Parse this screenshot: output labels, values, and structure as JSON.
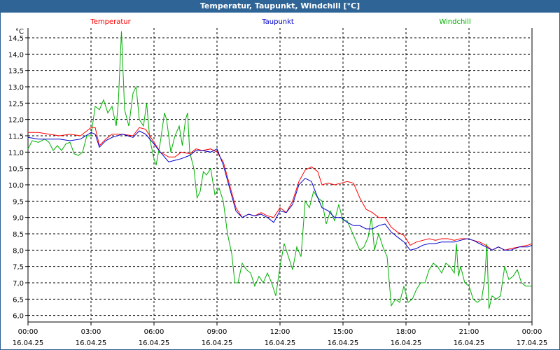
{
  "window": {
    "title": "Temperatur, Taupunkt, Windchill [°C]"
  },
  "colors": {
    "titlebar": "#2e6496",
    "temperatur": "#ff0000",
    "taupunkt": "#0000cc",
    "windchill": "#00b000",
    "grid": "#000000"
  },
  "chart_data": {
    "type": "line",
    "title": "Temperatur, Taupunkt, Windchill [°C]",
    "y_unit": "°C",
    "ylim": [
      5.8,
      14.8
    ],
    "y_ticks": [
      "6,0",
      "6,5",
      "7,0",
      "7,5",
      "8,0",
      "8,5",
      "9,0",
      "9,5",
      "10,0",
      "10,5",
      "11,0",
      "11,5",
      "12,0",
      "12,5",
      "13,0",
      "13,5",
      "14,0",
      "14,5"
    ],
    "xlim_hours": [
      0,
      24
    ],
    "x_ticks": [
      {
        "time": "00:00",
        "date": "16.04.25"
      },
      {
        "time": "03:00",
        "date": "16.04.25"
      },
      {
        "time": "06:00",
        "date": "16.04.25"
      },
      {
        "time": "09:00",
        "date": "16.04.25"
      },
      {
        "time": "12:00",
        "date": "16.04.25"
      },
      {
        "time": "15:00",
        "date": "16.04.25"
      },
      {
        "time": "18:00",
        "date": "16.04.25"
      },
      {
        "time": "21:00",
        "date": "16.04.25"
      },
      {
        "time": "00:00",
        "date": "17.04.25"
      }
    ],
    "grid": true,
    "legend_placement": "top",
    "series": [
      {
        "name": "Temperatur",
        "color": "#ff0000",
        "points": [
          [
            0,
            11.6
          ],
          [
            0.5,
            11.6
          ],
          [
            1.0,
            11.55
          ],
          [
            1.5,
            11.5
          ],
          [
            2.0,
            11.55
          ],
          [
            2.5,
            11.5
          ],
          [
            3.0,
            11.75
          ],
          [
            3.2,
            11.75
          ],
          [
            3.4,
            11.2
          ],
          [
            3.7,
            11.4
          ],
          [
            4.0,
            11.55
          ],
          [
            4.5,
            11.55
          ],
          [
            5.0,
            11.5
          ],
          [
            5.3,
            11.75
          ],
          [
            5.6,
            11.7
          ],
          [
            6.0,
            11.3
          ],
          [
            6.3,
            11.0
          ],
          [
            6.7,
            10.85
          ],
          [
            7.0,
            10.85
          ],
          [
            7.3,
            11.0
          ],
          [
            7.7,
            10.95
          ],
          [
            8.0,
            11.1
          ],
          [
            8.3,
            11.05
          ],
          [
            8.7,
            11.1
          ],
          [
            9.0,
            11.0
          ],
          [
            9.3,
            10.7
          ],
          [
            9.6,
            10.0
          ],
          [
            9.9,
            9.3
          ],
          [
            10.2,
            9.0
          ],
          [
            10.5,
            9.1
          ],
          [
            10.8,
            9.05
          ],
          [
            11.1,
            9.15
          ],
          [
            11.4,
            9.05
          ],
          [
            11.7,
            9.0
          ],
          [
            12.0,
            9.3
          ],
          [
            12.3,
            9.15
          ],
          [
            12.6,
            9.5
          ],
          [
            12.9,
            10.1
          ],
          [
            13.2,
            10.45
          ],
          [
            13.5,
            10.55
          ],
          [
            13.8,
            10.4
          ],
          [
            14.0,
            10.0
          ],
          [
            14.3,
            10.05
          ],
          [
            14.6,
            10.0
          ],
          [
            14.9,
            10.05
          ],
          [
            15.2,
            10.1
          ],
          [
            15.5,
            10.05
          ],
          [
            15.8,
            9.6
          ],
          [
            16.1,
            9.25
          ],
          [
            16.4,
            9.15
          ],
          [
            16.7,
            9.0
          ],
          [
            17.0,
            9.0
          ],
          [
            17.3,
            8.7
          ],
          [
            17.6,
            8.55
          ],
          [
            17.9,
            8.45
          ],
          [
            18.2,
            8.15
          ],
          [
            18.5,
            8.25
          ],
          [
            18.8,
            8.3
          ],
          [
            19.1,
            8.35
          ],
          [
            19.4,
            8.3
          ],
          [
            19.7,
            8.35
          ],
          [
            20.0,
            8.35
          ],
          [
            20.3,
            8.3
          ],
          [
            20.6,
            8.35
          ],
          [
            20.9,
            8.35
          ],
          [
            21.2,
            8.3
          ],
          [
            21.5,
            8.25
          ],
          [
            21.8,
            8.15
          ],
          [
            22.1,
            8.0
          ],
          [
            22.4,
            8.1
          ],
          [
            22.7,
            8.0
          ],
          [
            23.0,
            8.05
          ],
          [
            23.4,
            8.1
          ],
          [
            23.8,
            8.15
          ],
          [
            24.0,
            8.2
          ]
        ]
      },
      {
        "name": "Taupunkt",
        "color": "#0000cc",
        "points": [
          [
            0,
            11.45
          ],
          [
            0.5,
            11.4
          ],
          [
            1.0,
            11.4
          ],
          [
            1.5,
            11.4
          ],
          [
            2.0,
            11.35
          ],
          [
            2.5,
            11.4
          ],
          [
            3.0,
            11.6
          ],
          [
            3.2,
            11.55
          ],
          [
            3.4,
            11.15
          ],
          [
            3.7,
            11.35
          ],
          [
            4.0,
            11.45
          ],
          [
            4.5,
            11.55
          ],
          [
            5.0,
            11.45
          ],
          [
            5.3,
            11.65
          ],
          [
            5.6,
            11.55
          ],
          [
            6.0,
            11.25
          ],
          [
            6.3,
            11.0
          ],
          [
            6.7,
            10.7
          ],
          [
            7.0,
            10.75
          ],
          [
            7.3,
            10.8
          ],
          [
            7.7,
            10.9
          ],
          [
            8.0,
            11.05
          ],
          [
            8.3,
            11.05
          ],
          [
            8.7,
            11.0
          ],
          [
            9.0,
            11.1
          ],
          [
            9.3,
            10.6
          ],
          [
            9.6,
            9.9
          ],
          [
            9.9,
            9.2
          ],
          [
            10.2,
            9.0
          ],
          [
            10.5,
            9.1
          ],
          [
            10.8,
            9.05
          ],
          [
            11.1,
            9.1
          ],
          [
            11.4,
            9.0
          ],
          [
            11.7,
            8.85
          ],
          [
            12.0,
            9.2
          ],
          [
            12.3,
            9.15
          ],
          [
            12.6,
            9.4
          ],
          [
            12.9,
            10.0
          ],
          [
            13.2,
            10.2
          ],
          [
            13.5,
            10.1
          ],
          [
            13.8,
            9.6
          ],
          [
            14.0,
            9.3
          ],
          [
            14.3,
            9.2
          ],
          [
            14.6,
            9.0
          ],
          [
            14.9,
            9.0
          ],
          [
            15.2,
            8.85
          ],
          [
            15.5,
            8.75
          ],
          [
            15.8,
            8.75
          ],
          [
            16.1,
            8.65
          ],
          [
            16.4,
            8.65
          ],
          [
            16.7,
            8.75
          ],
          [
            17.0,
            8.8
          ],
          [
            17.3,
            8.55
          ],
          [
            17.6,
            8.4
          ],
          [
            17.9,
            8.25
          ],
          [
            18.2,
            8.0
          ],
          [
            18.5,
            8.05
          ],
          [
            18.8,
            8.15
          ],
          [
            19.1,
            8.2
          ],
          [
            19.4,
            8.2
          ],
          [
            19.7,
            8.25
          ],
          [
            20.0,
            8.25
          ],
          [
            20.3,
            8.25
          ],
          [
            20.6,
            8.3
          ],
          [
            20.9,
            8.35
          ],
          [
            21.2,
            8.3
          ],
          [
            21.5,
            8.2
          ],
          [
            21.8,
            8.1
          ],
          [
            22.1,
            8.0
          ],
          [
            22.4,
            8.1
          ],
          [
            22.7,
            8.0
          ],
          [
            23.0,
            8.0
          ],
          [
            23.4,
            8.1
          ],
          [
            23.8,
            8.1
          ],
          [
            24.0,
            8.15
          ]
        ]
      },
      {
        "name": "Windchill",
        "color": "#00b000",
        "points": [
          [
            0,
            11.1
          ],
          [
            0.2,
            11.35
          ],
          [
            0.5,
            11.3
          ],
          [
            0.8,
            11.4
          ],
          [
            1.0,
            11.3
          ],
          [
            1.2,
            11.05
          ],
          [
            1.4,
            11.2
          ],
          [
            1.6,
            11.05
          ],
          [
            1.8,
            11.25
          ],
          [
            2.0,
            11.3
          ],
          [
            2.2,
            10.95
          ],
          [
            2.4,
            10.9
          ],
          [
            2.6,
            11.0
          ],
          [
            2.8,
            11.5
          ],
          [
            3.0,
            11.5
          ],
          [
            3.2,
            12.4
          ],
          [
            3.4,
            12.3
          ],
          [
            3.6,
            12.6
          ],
          [
            3.8,
            12.2
          ],
          [
            4.0,
            12.4
          ],
          [
            4.2,
            11.8
          ],
          [
            4.3,
            12.5
          ],
          [
            4.45,
            14.7
          ],
          [
            4.6,
            12.3
          ],
          [
            4.8,
            11.8
          ],
          [
            5.0,
            12.8
          ],
          [
            5.15,
            13.0
          ],
          [
            5.3,
            12.0
          ],
          [
            5.5,
            11.8
          ],
          [
            5.65,
            12.5
          ],
          [
            5.8,
            11.4
          ],
          [
            6.0,
            10.8
          ],
          [
            6.1,
            10.6
          ],
          [
            6.3,
            11.3
          ],
          [
            6.5,
            12.2
          ],
          [
            6.6,
            12.0
          ],
          [
            6.8,
            11.0
          ],
          [
            7.0,
            11.5
          ],
          [
            7.2,
            11.8
          ],
          [
            7.35,
            11.2
          ],
          [
            7.5,
            12.0
          ],
          [
            7.6,
            12.2
          ],
          [
            7.7,
            11.0
          ],
          [
            7.9,
            10.5
          ],
          [
            8.05,
            9.6
          ],
          [
            8.2,
            9.8
          ],
          [
            8.35,
            10.4
          ],
          [
            8.5,
            10.3
          ],
          [
            8.7,
            10.5
          ],
          [
            8.9,
            9.7
          ],
          [
            9.1,
            9.9
          ],
          [
            9.3,
            9.5
          ],
          [
            9.5,
            8.5
          ],
          [
            9.7,
            7.9
          ],
          [
            9.85,
            7.0
          ],
          [
            10.0,
            7.0
          ],
          [
            10.2,
            7.6
          ],
          [
            10.4,
            7.4
          ],
          [
            10.6,
            7.3
          ],
          [
            10.8,
            6.9
          ],
          [
            11.0,
            7.2
          ],
          [
            11.2,
            7.0
          ],
          [
            11.4,
            7.3
          ],
          [
            11.6,
            7.0
          ],
          [
            11.8,
            6.6
          ],
          [
            12.0,
            7.5
          ],
          [
            12.2,
            8.2
          ],
          [
            12.4,
            7.8
          ],
          [
            12.6,
            7.4
          ],
          [
            12.8,
            8.1
          ],
          [
            13.0,
            7.8
          ],
          [
            13.2,
            9.5
          ],
          [
            13.4,
            9.3
          ],
          [
            13.6,
            9.8
          ],
          [
            13.8,
            9.6
          ],
          [
            14.0,
            9.5
          ],
          [
            14.2,
            8.8
          ],
          [
            14.4,
            9.2
          ],
          [
            14.6,
            8.9
          ],
          [
            14.8,
            9.4
          ],
          [
            15.0,
            8.9
          ],
          [
            15.2,
            8.9
          ],
          [
            15.4,
            8.6
          ],
          [
            15.6,
            8.3
          ],
          [
            15.8,
            8.0
          ],
          [
            16.0,
            8.1
          ],
          [
            16.2,
            8.4
          ],
          [
            16.35,
            9.0
          ],
          [
            16.5,
            8.0
          ],
          [
            16.7,
            8.5
          ],
          [
            16.9,
            8.1
          ],
          [
            17.1,
            7.8
          ],
          [
            17.3,
            6.3
          ],
          [
            17.5,
            6.5
          ],
          [
            17.7,
            6.4
          ],
          [
            17.9,
            6.9
          ],
          [
            18.1,
            6.4
          ],
          [
            18.3,
            6.5
          ],
          [
            18.5,
            6.8
          ],
          [
            18.7,
            7.0
          ],
          [
            18.9,
            7.0
          ],
          [
            19.1,
            7.4
          ],
          [
            19.3,
            7.6
          ],
          [
            19.5,
            7.5
          ],
          [
            19.7,
            7.3
          ],
          [
            19.9,
            7.6
          ],
          [
            20.1,
            7.5
          ],
          [
            20.3,
            7.3
          ],
          [
            20.4,
            8.2
          ],
          [
            20.5,
            7.2
          ],
          [
            20.6,
            7.5
          ],
          [
            20.8,
            7.0
          ],
          [
            21.0,
            6.9
          ],
          [
            21.2,
            6.5
          ],
          [
            21.4,
            6.4
          ],
          [
            21.6,
            6.5
          ],
          [
            21.75,
            7.1
          ],
          [
            21.85,
            8.2
          ],
          [
            21.95,
            6.2
          ],
          [
            22.1,
            6.6
          ],
          [
            22.3,
            6.5
          ],
          [
            22.5,
            6.6
          ],
          [
            22.7,
            7.5
          ],
          [
            22.9,
            7.1
          ],
          [
            23.1,
            7.2
          ],
          [
            23.3,
            7.4
          ],
          [
            23.5,
            7.0
          ],
          [
            23.7,
            6.9
          ],
          [
            24.0,
            6.9
          ]
        ]
      }
    ]
  }
}
